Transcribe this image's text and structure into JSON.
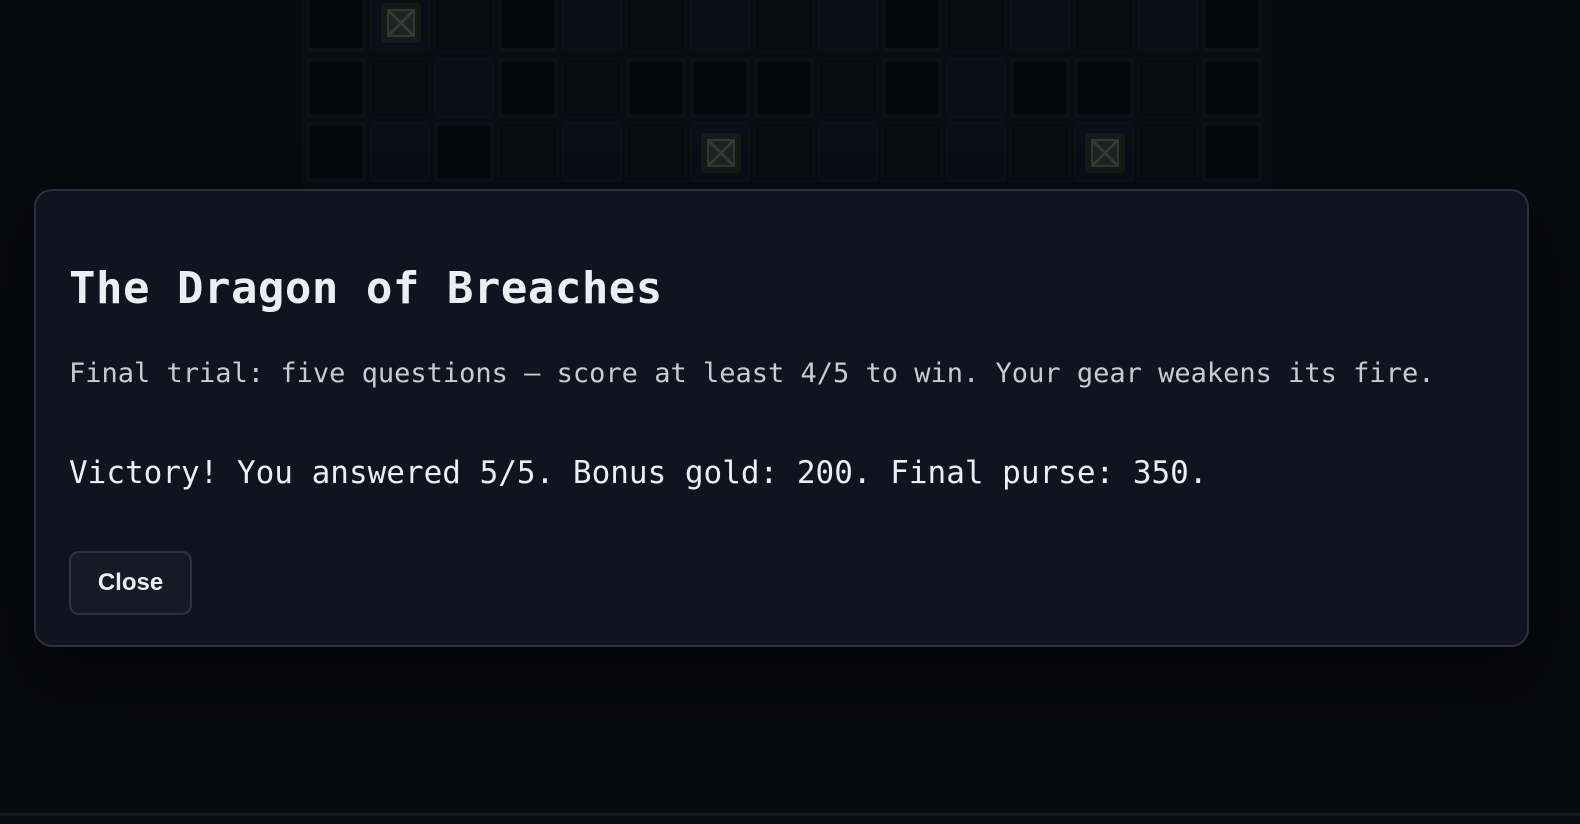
{
  "game_board": {
    "description_marker_icon": "crate-x-icon"
  },
  "modal": {
    "title": "The Dragon of Breaches",
    "intro": "Final trial: five questions — score at least 4/5 to win. Your gear weakens its fire.",
    "result": "Victory! You answered 5/5. Bonus gold: 200. Final purse: 350.",
    "close_label": "Close"
  },
  "colors": {
    "background": "#0a0b0f",
    "modal_bg": "#11141f",
    "modal_border": "#2a3140",
    "title_text": "#eceef3",
    "body_text": "#c8cbd2"
  }
}
